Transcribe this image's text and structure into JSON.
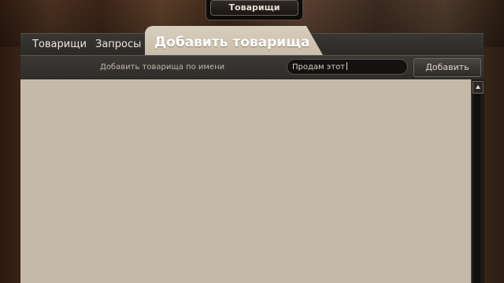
{
  "top_button": {
    "label": "Товарищи"
  },
  "tabs": [
    {
      "label": "Товарищи",
      "active": false
    },
    {
      "label": "Запросы",
      "active": false
    },
    {
      "label": "Добавить товарища",
      "active": true
    }
  ],
  "toolbar": {
    "prompt": "Добавить товарища по имени",
    "name_input_value": "Продам этот",
    "add_button_label": "Добавить"
  },
  "icons": {
    "scroll_up": "arrow-up-icon"
  },
  "colors": {
    "content_bg": "#c5b9aa",
    "active_tab_bg": "#d9cfbe",
    "panel_dark": "#2e2c29"
  }
}
